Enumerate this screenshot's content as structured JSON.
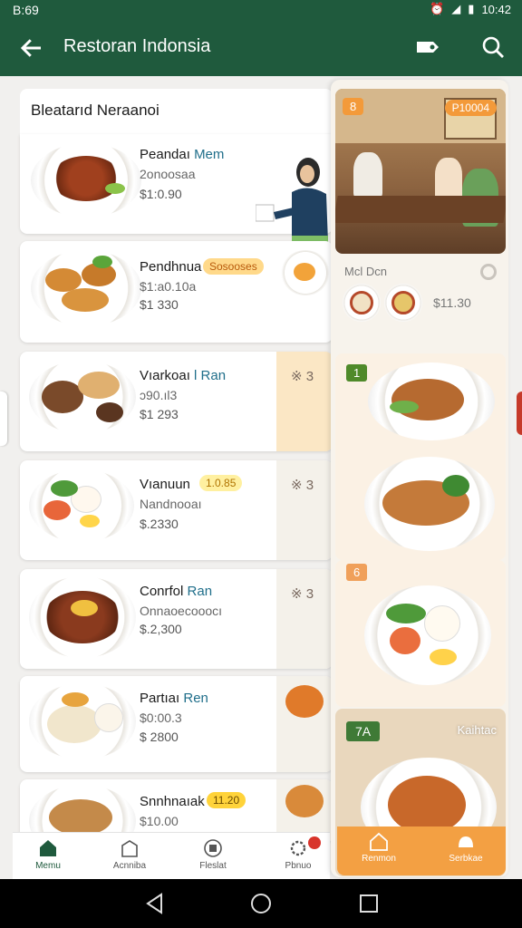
{
  "status": {
    "time": "B:69",
    "right_time": "10:42"
  },
  "appbar": {
    "title": "Restoran Indonsia"
  },
  "menu": {
    "header": "Bleatarıd Neraanoi",
    "items": [
      {
        "name": "Peandaı",
        "name_accent": "Mem",
        "sub": "2onoosaa",
        "price": "$1:0.90",
        "badge": ""
      },
      {
        "name": "Pendhnua",
        "name_accent": "",
        "sub": "$1:a0.10a",
        "price": "$1 330",
        "badge": "Sosooses"
      },
      {
        "name": "Vıarkoaı",
        "name_accent": "l Ran",
        "sub": "ɔ90.ıl3",
        "price": "$1 293",
        "badge": ""
      },
      {
        "name": "Vıanuun",
        "name_accent": "",
        "sub": "Nandnooaı",
        "price": "$.2330",
        "badge": "1.0.85"
      },
      {
        "name": "Conrfol",
        "name_accent": "Ran",
        "sub": "Onnaoecooocı",
        "price": "$.2,300",
        "badge": ""
      },
      {
        "name": "Partıaı",
        "name_accent": "Ren",
        "sub": "$0:00.3",
        "price": "$ 2800",
        "badge": ""
      },
      {
        "name": "Snnhnaıak",
        "name_accent": "",
        "sub": "$10.00",
        "price": "",
        "badge": "11.20"
      }
    ],
    "strip_marks": [
      "※ 3",
      "※ 3",
      "※ 3"
    ]
  },
  "right_panel": {
    "photo_badge_left": "8",
    "photo_badge_right": "P10004",
    "label": "Mcl Dcn",
    "price": "$11.30",
    "card_numbers": [
      "1",
      "6"
    ],
    "bottom_number": "7A",
    "bottom_label": "Kaihtac",
    "nav": [
      "Renmon",
      "Serbkae"
    ]
  },
  "bottom_nav": [
    "Memu",
    "Acnniba",
    "Fleslat",
    "Pbnuo"
  ],
  "colors": {
    "primary": "#1f5a3d",
    "accent": "#f3a043"
  }
}
